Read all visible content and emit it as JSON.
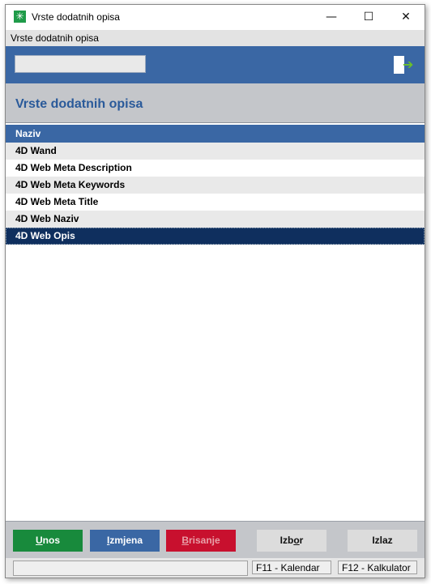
{
  "window": {
    "title": "Vrste dodatnih opisa",
    "minimize_glyph": "—",
    "maximize_glyph": "☐",
    "close_glyph": "✕",
    "app_icon_glyph": "✳",
    "app_icon_color": "#1f9b49"
  },
  "menubar": {
    "label": "Vrste dodatnih opisa"
  },
  "toolbar": {
    "search_value": "",
    "exit_icon": "exit-arrow-icon",
    "exit_glyph": "➔"
  },
  "header": {
    "title": "Vrste dodatnih opisa"
  },
  "table": {
    "column": "Naziv",
    "rows": [
      {
        "label": "4D Wand"
      },
      {
        "label": "4D Web Meta Description"
      },
      {
        "label": "4D Web Meta Keywords"
      },
      {
        "label": "4D Web Meta Title"
      },
      {
        "label": "4D Web Naziv"
      },
      {
        "label": "4D Web Opis"
      }
    ],
    "selected_row": "4D Web Opis"
  },
  "buttons": {
    "unos_u": "U",
    "unos_rest": "nos",
    "izmjena_u": "I",
    "izmjena_rest": "zmjena",
    "brisanje_u": "B",
    "brisanje_rest": "risanje",
    "izbor_a": "Izb",
    "izbor_u": "o",
    "izbor_b": "r",
    "izlaz": "Izlaz"
  },
  "statusbar": {
    "f11": "F11 - Kalendar",
    "f12": "F12 - Kalkulator"
  },
  "colors": {
    "blue": "#3a67a4",
    "selected": "#0f2f5e",
    "green": "#188a3c",
    "red": "#c8102e",
    "heading": "#2a5a9a"
  }
}
